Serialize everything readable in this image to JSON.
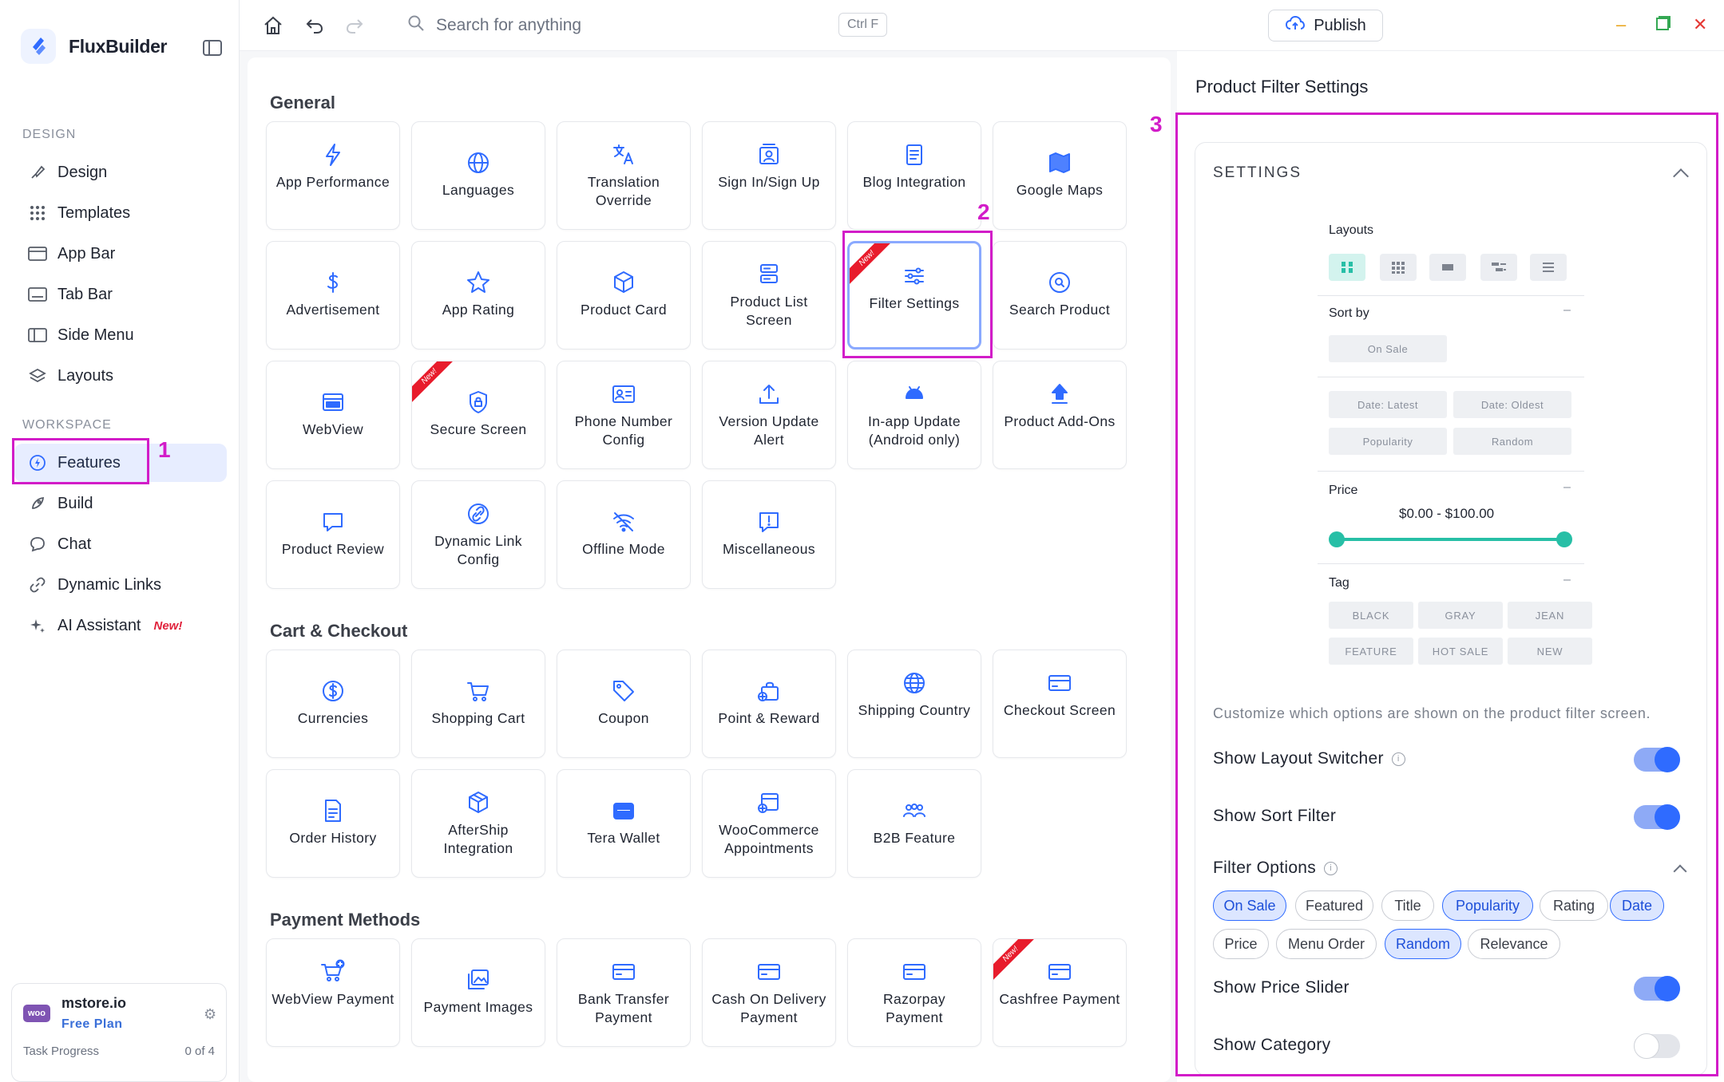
{
  "app": {
    "name": "FluxBuilder",
    "sections": {
      "design": "DESIGN",
      "workspace": "WORKSPACE"
    },
    "design_nav": [
      "Design",
      "Templates",
      "App Bar",
      "Tab Bar",
      "Side Menu",
      "Layouts"
    ],
    "workspace_nav": [
      "Features",
      "Build",
      "Chat",
      "Dynamic Links",
      "AI Assistant"
    ],
    "new_tag": "New!",
    "plan": {
      "site": "mstore.io",
      "tier": "Free Plan",
      "logo": "woo",
      "progress_label": "Task Progress",
      "progress_value": "0 of 4"
    }
  },
  "topbar": {
    "search_placeholder": "Search for anything",
    "shortcut": "Ctrl F",
    "publish": "Publish"
  },
  "annotations": {
    "one": "1",
    "two": "2",
    "three": "3"
  },
  "groups": {
    "general": {
      "title": "General",
      "cards": [
        "App Performance",
        "Languages",
        "Translation Override",
        "Sign In/Sign Up",
        "Blog Integration",
        "Google Maps",
        "Advertisement",
        "App Rating",
        "Product Card",
        "Product List Screen",
        "Filter Settings",
        "Search Product",
        "WebView",
        "Secure Screen",
        "Phone Number Config",
        "Version Update Alert",
        "In-app Update (Android only)",
        "Product Add-Ons",
        "Product Review",
        "Dynamic Link Config",
        "Offline Mode",
        "Miscellaneous"
      ]
    },
    "cart": {
      "title": "Cart & Checkout",
      "cards": [
        "Currencies",
        "Shopping Cart",
        "Coupon",
        "Point & Reward",
        "Shipping Country",
        "Checkout Screen",
        "Order History",
        "AfterShip Integration",
        "Tera Wallet",
        "WooCommerce Appointments",
        "B2B Feature"
      ]
    },
    "payment": {
      "title": "Payment Methods",
      "cards": [
        "WebView Payment",
        "Payment Images",
        "Bank Transfer Payment",
        "Cash On Delivery Payment",
        "Razorpay Payment",
        "Cashfree Payment"
      ]
    }
  },
  "panel": {
    "title": "Product Filter Settings",
    "section": "SETTINGS",
    "preview": {
      "layouts": "Layouts",
      "sort_by": "Sort by",
      "sort_chips": [
        "On Sale",
        "Date: Latest",
        "Date: Oldest",
        "Popularity",
        "Random"
      ],
      "price": "Price",
      "price_range": "$0.00 - $100.00",
      "price_min": 0,
      "price_max": 100,
      "tag": "Tag",
      "tags": [
        "BLACK",
        "GRAY",
        "JEAN",
        "FEATURE",
        "HOT SALE",
        "NEW"
      ],
      "dash": "–"
    },
    "description": "Customize which options are shown on the product filter screen.",
    "show_layout_switcher": "Show Layout Switcher",
    "show_sort_filter": "Show Sort Filter",
    "filter_options": "Filter Options",
    "options": [
      {
        "label": "On Sale",
        "on": true
      },
      {
        "label": "Featured",
        "on": false
      },
      {
        "label": "Title",
        "on": false
      },
      {
        "label": "Popularity",
        "on": true
      },
      {
        "label": "Rating",
        "on": false
      },
      {
        "label": "Date",
        "on": true
      },
      {
        "label": "Price",
        "on": false
      },
      {
        "label": "Menu Order",
        "on": false
      },
      {
        "label": "Random",
        "on": true
      },
      {
        "label": "Relevance",
        "on": false
      }
    ],
    "show_price_slider": "Show Price Slider",
    "show_category": "Show Category",
    "toggles": {
      "layout_switcher": true,
      "sort_filter": true,
      "price_slider": true,
      "category": false
    }
  },
  "colors": {
    "accent": "#2f6bff",
    "highlight": "#d21cc8",
    "teal": "#27bfa6",
    "new_red": "#e81c2c"
  }
}
